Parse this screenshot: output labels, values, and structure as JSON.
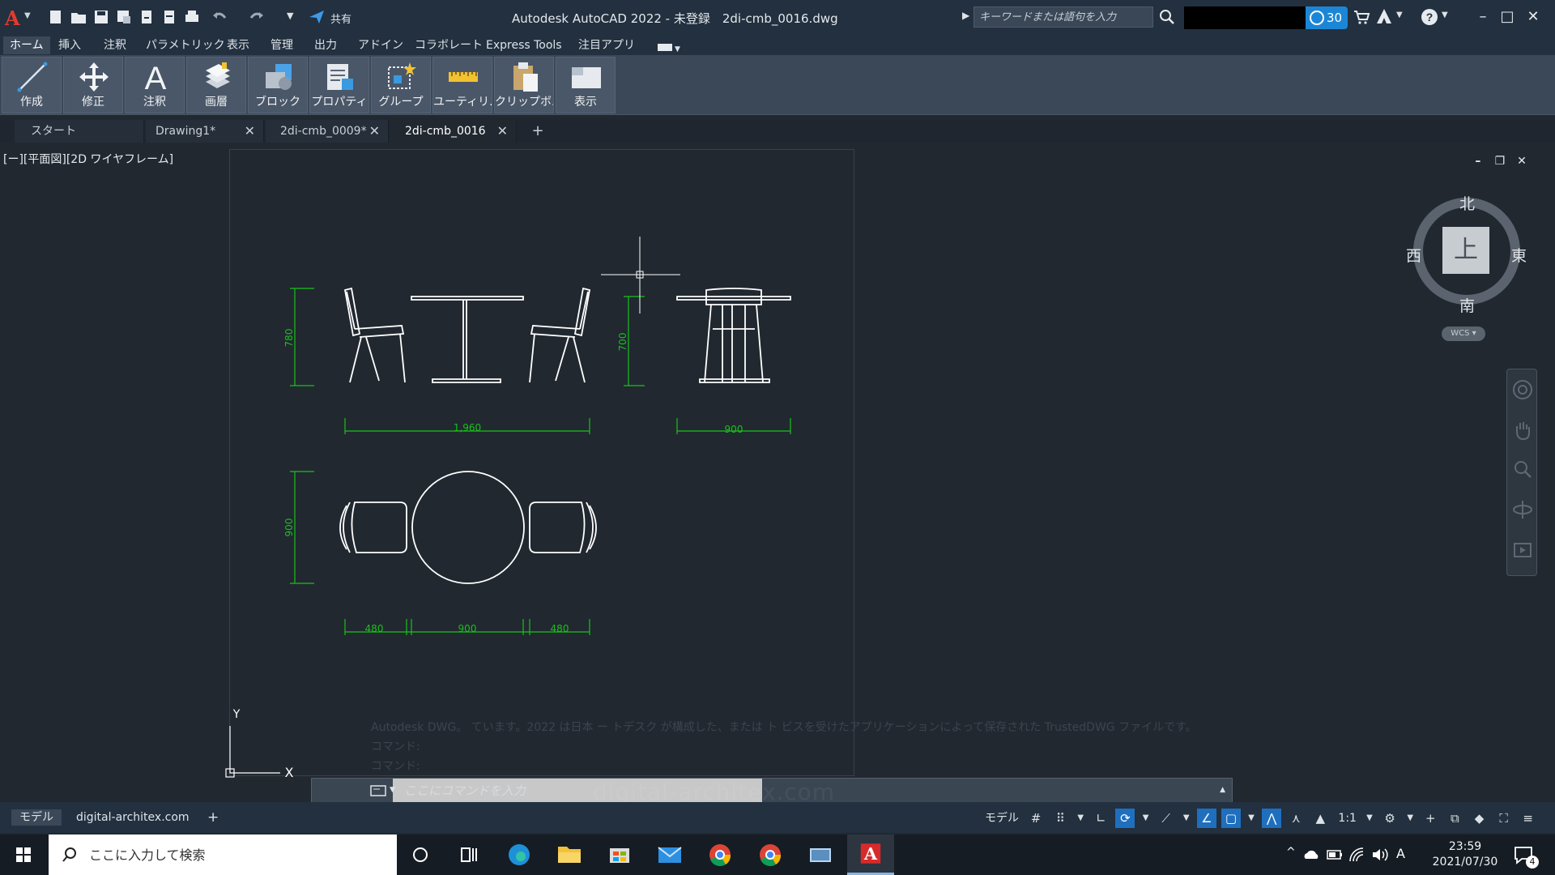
{
  "titlebar": {
    "app_logo": "A",
    "title": "Autodesk AutoCAD 2022 - 未登録　2di-cmb_0016.dwg",
    "share_label": "共有",
    "search_placeholder": "キーワードまたは語句を入力",
    "trial_days": "30"
  },
  "ribbon": {
    "tabs": [
      "ホーム",
      "挿入",
      "注釈",
      "パラメトリック",
      "表示",
      "管理",
      "出力",
      "アドイン",
      "コラボレート",
      "Express Tools",
      "注目アプリ"
    ],
    "active_tab": "ホーム",
    "buttons": [
      {
        "label": "作成",
        "icon": "line-icon"
      },
      {
        "label": "修正",
        "icon": "move-icon"
      },
      {
        "label": "注釈",
        "icon": "text-icon"
      },
      {
        "label": "画層",
        "icon": "layers-icon"
      },
      {
        "label": "ブロック",
        "icon": "block-icon"
      },
      {
        "label": "プロパティ",
        "icon": "properties-icon"
      },
      {
        "label": "グループ",
        "icon": "group-icon"
      },
      {
        "label": "ユーティリ...",
        "icon": "measure-icon"
      },
      {
        "label": "クリップボ...",
        "icon": "clipboard-icon"
      },
      {
        "label": "表示",
        "icon": "view-icon"
      }
    ]
  },
  "file_tabs": [
    {
      "label": "スタート",
      "closable": false
    },
    {
      "label": "Drawing1*",
      "closable": true
    },
    {
      "label": "2di-cmb_0009*",
      "closable": true
    },
    {
      "label": "2di-cmb_0016",
      "closable": true,
      "active": true
    }
  ],
  "viewport": {
    "label": "[ー][平面図][2D ワイヤフレーム]",
    "viewcube": {
      "north": "北",
      "south": "南",
      "east": "東",
      "west": "西",
      "top": "上"
    },
    "wcs": "WCS",
    "ucs_x": "X",
    "ucs_y": "Y"
  },
  "drawing": {
    "dimensions": {
      "elev_height_left": "780",
      "elev_height_right": "700",
      "elev_width_left": "1,960",
      "elev_width_right": "900",
      "plan_depth": "900",
      "plan_w1": "480",
      "plan_w2": "900",
      "plan_w3": "480"
    },
    "dim_color": "#19c219",
    "line_color": "#ffffff"
  },
  "command": {
    "history": [
      "Autodesk DWG。 ています。2022 は日本 ー トデスク が構成した、または ト ビスを受けたアプリケーションによって保存された TrustedDWG ファイルです。",
      "コマンド:",
      "コマンド:"
    ],
    "placeholder": "ここにコマンドを入力",
    "watermark": "digital-architex.com"
  },
  "status_bar": {
    "layout_tabs": [
      "モデル",
      "digital-architex.com"
    ],
    "model_label": "モデル",
    "scale": "1:1"
  },
  "taskbar": {
    "search_placeholder": "ここに入力して検索",
    "time": "23:59",
    "date": "2021/07/30",
    "ime": "A",
    "notification_count": "4"
  }
}
